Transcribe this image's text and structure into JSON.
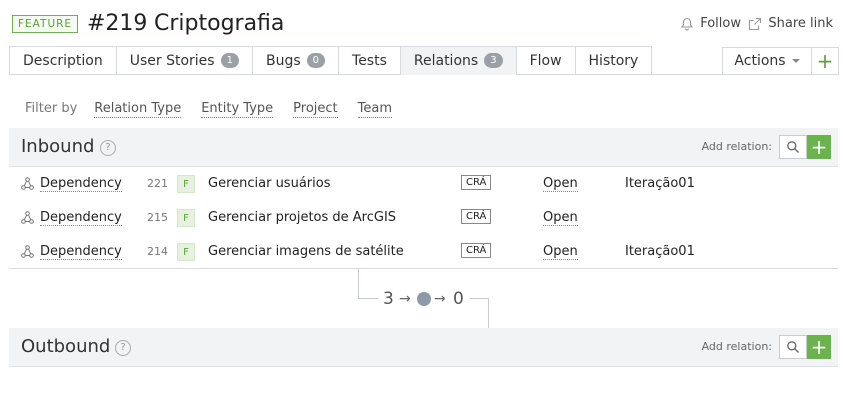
{
  "header": {
    "badge": "FEATURE",
    "id": "#219",
    "title": "Criptografia",
    "follow": "Follow",
    "share": "Share link"
  },
  "tabs": [
    {
      "label": "Description",
      "count": null
    },
    {
      "label": "User Stories",
      "count": "1"
    },
    {
      "label": "Bugs",
      "count": "0"
    },
    {
      "label": "Tests",
      "count": null
    },
    {
      "label": "Relations",
      "count": "3",
      "active": true
    },
    {
      "label": "Flow",
      "count": null
    },
    {
      "label": "History",
      "count": null
    }
  ],
  "actions": {
    "label": "Actions",
    "add": "+"
  },
  "filter": {
    "label": "Filter by",
    "options": [
      "Relation Type",
      "Entity Type",
      "Project",
      "Team"
    ]
  },
  "inbound": {
    "title": "Inbound",
    "help": "?",
    "add_relation": "Add relation:",
    "rows": [
      {
        "type": "Dependency",
        "id": "221",
        "entity": "F",
        "name": "Gerenciar usuários",
        "project": "CRÁ",
        "state": "Open",
        "iteration": "Iteração01"
      },
      {
        "type": "Dependency",
        "id": "215",
        "entity": "F",
        "name": "Gerenciar projetos de ArcGIS",
        "project": "CRÁ",
        "state": "Open",
        "iteration": ""
      },
      {
        "type": "Dependency",
        "id": "214",
        "entity": "F",
        "name": "Gerenciar imagens de satélite",
        "project": "CRÁ",
        "state": "Open",
        "iteration": "Iteração01"
      }
    ]
  },
  "flow": {
    "inbound_count": "3",
    "outbound_count": "0",
    "arrow": "→"
  },
  "outbound": {
    "title": "Outbound",
    "help": "?",
    "add_relation": "Add relation:"
  },
  "colors": {
    "accent_green": "#6bb34d",
    "badge_gray": "#9aa0a6",
    "section_bg": "#f1f3f5"
  }
}
